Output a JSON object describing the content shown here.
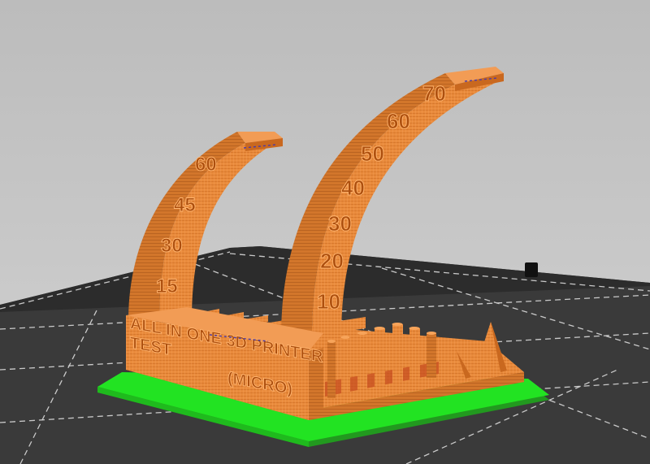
{
  "scene": {
    "background_top": "#bcbcbc",
    "background_bottom": "#d2d2d2",
    "bed_color": "#3a3a3a",
    "grid_color": "#e4e4e4",
    "model_color": "#e98b3c",
    "model_shadow": "#b85f1c",
    "raft_color": "#22e322",
    "raft_base_color": "#22991f"
  },
  "model": {
    "front_text_line1": "ALL IN ONE 3D PRINTER",
    "front_text_line2": "TEST",
    "front_text_line3": "(MICRO)",
    "left_arch_labels": [
      "60",
      "45",
      "30",
      "15"
    ],
    "right_arch_labels": [
      "70",
      "60",
      "50",
      "40",
      "30",
      "20",
      "10"
    ]
  }
}
